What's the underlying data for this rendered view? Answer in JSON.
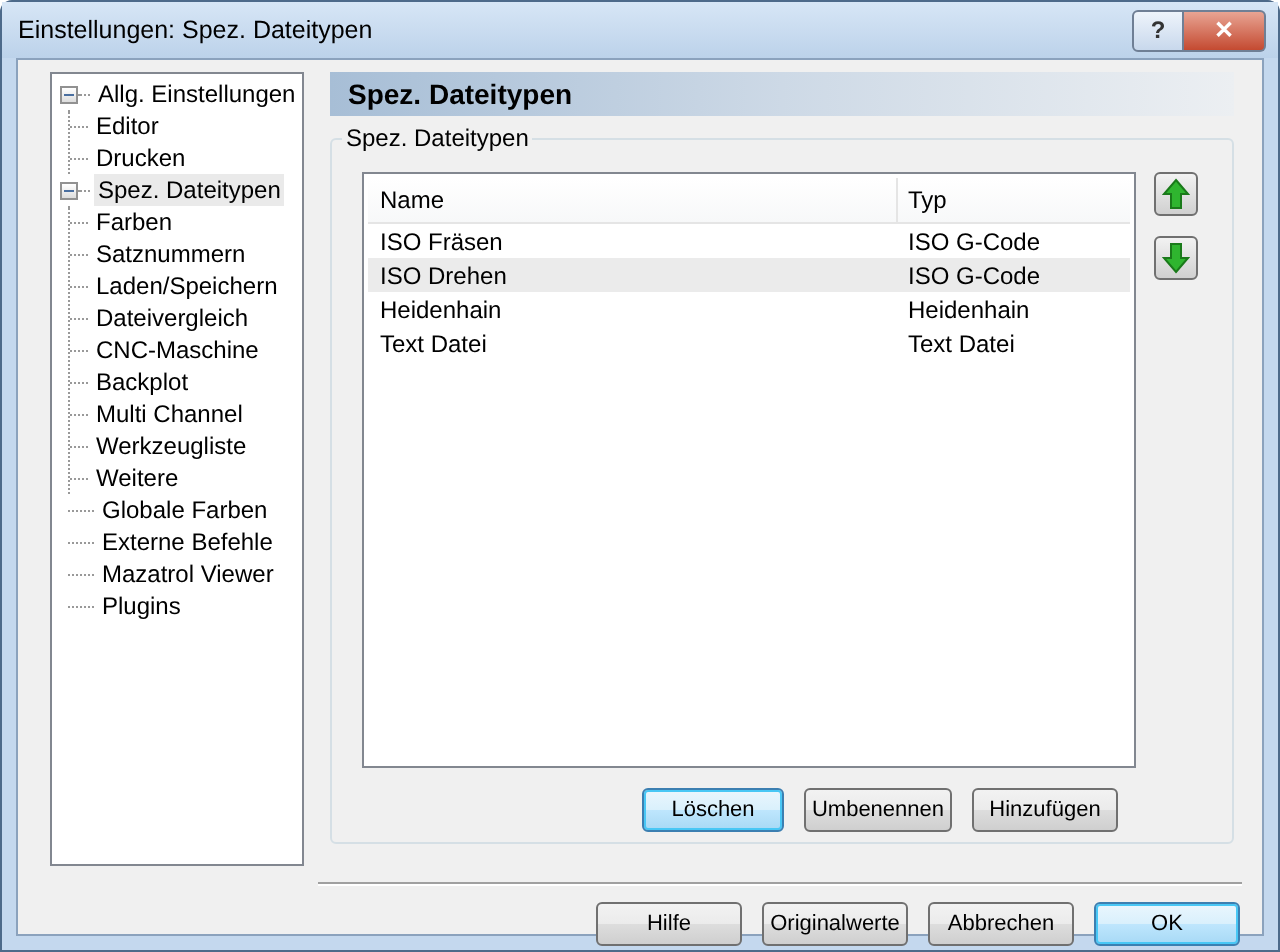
{
  "window": {
    "title": "Einstellungen: Spez. Dateitypen",
    "help": "?",
    "close": "✕"
  },
  "tree": [
    {
      "label": "Allg. Einstellungen",
      "selected": false,
      "expanded": true,
      "children": [
        {
          "label": "Editor",
          "selected": false
        },
        {
          "label": "Drucken",
          "selected": false
        }
      ]
    },
    {
      "label": "Spez. Dateitypen",
      "selected": true,
      "expanded": true,
      "children": [
        {
          "label": "Farben",
          "selected": false
        },
        {
          "label": "Satznummern",
          "selected": false
        },
        {
          "label": "Laden/Speichern",
          "selected": false
        },
        {
          "label": "Dateivergleich",
          "selected": false
        },
        {
          "label": "CNC-Maschine",
          "selected": false
        },
        {
          "label": "Backplot",
          "selected": false
        },
        {
          "label": "Multi Channel",
          "selected": false
        },
        {
          "label": "Werkzeugliste",
          "selected": false
        },
        {
          "label": "Weitere",
          "selected": false
        }
      ]
    },
    {
      "label": "Globale Farben",
      "selected": false
    },
    {
      "label": "Externe Befehle",
      "selected": false
    },
    {
      "label": "Mazatrol Viewer",
      "selected": false
    },
    {
      "label": "Plugins",
      "selected": false
    }
  ],
  "header": "Spez. Dateitypen",
  "group": {
    "title": "Spez. Dateitypen",
    "table": {
      "columns": [
        "Name",
        "Typ"
      ],
      "rows": [
        {
          "cells": [
            "ISO Fräsen",
            "ISO G-Code"
          ],
          "selected": false
        },
        {
          "cells": [
            "ISO Drehen",
            "ISO G-Code"
          ],
          "selected": true
        },
        {
          "cells": [
            "Heidenhain",
            "Heidenhain"
          ],
          "selected": false
        },
        {
          "cells": [
            "Text Datei",
            "Text Datei"
          ],
          "selected": false
        }
      ]
    },
    "buttons": [
      {
        "label": "Löschen",
        "focused": true
      },
      {
        "label": "Umbenennen",
        "focused": false
      },
      {
        "label": "Hinzufügen",
        "focused": false
      }
    ]
  },
  "footer_buttons": [
    {
      "label": "Hilfe",
      "focused": false
    },
    {
      "label": "Originalwerte",
      "focused": false
    },
    {
      "label": "Abbrechen",
      "focused": false
    },
    {
      "label": "OK",
      "focused": true
    }
  ]
}
